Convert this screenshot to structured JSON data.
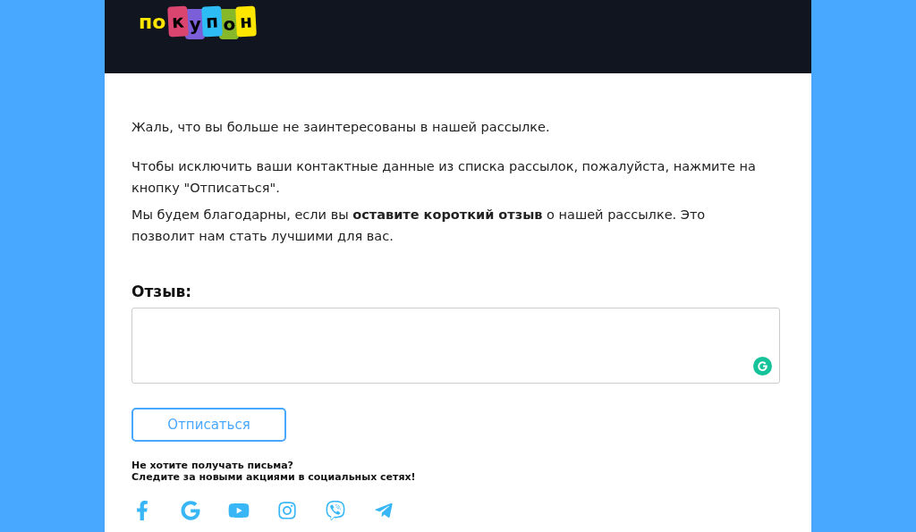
{
  "logo": {
    "prefix": "по",
    "tags": [
      {
        "letter": "к",
        "color": "#d9456f"
      },
      {
        "letter": "у",
        "color": "#7b5fd8"
      },
      {
        "letter": "п",
        "color": "#2ebcf5"
      },
      {
        "letter": "о",
        "color": "#86b82a"
      },
      {
        "letter": "н",
        "color": "#ffe600"
      }
    ]
  },
  "paragraphs": [
    "Жаль, что вы больше не заинтересованы в нашей рассылке.",
    "Чтобы исключить ваши контактные данные из списка рассылок, пожалуйста, нажмите на кнопку \"Отписаться\".",
    "Мы будем благодарны, если вы **оставите короткий отзыв** о нашей рассылке. Это позволит нам стать лучшими для вас."
  ],
  "feedback": {
    "label": "Отзыв:"
  },
  "unsubscribe_button": "Отписаться",
  "footer": {
    "lines": [
      "Не хотите получать письма?",
      "Следите за новыми акциями в социальных сетях!"
    ]
  },
  "social": [
    {
      "kind": "facebook"
    },
    {
      "kind": "google"
    },
    {
      "kind": "youtube"
    },
    {
      "kind": "instagram"
    },
    {
      "kind": "viber"
    },
    {
      "kind": "telegram"
    }
  ]
}
